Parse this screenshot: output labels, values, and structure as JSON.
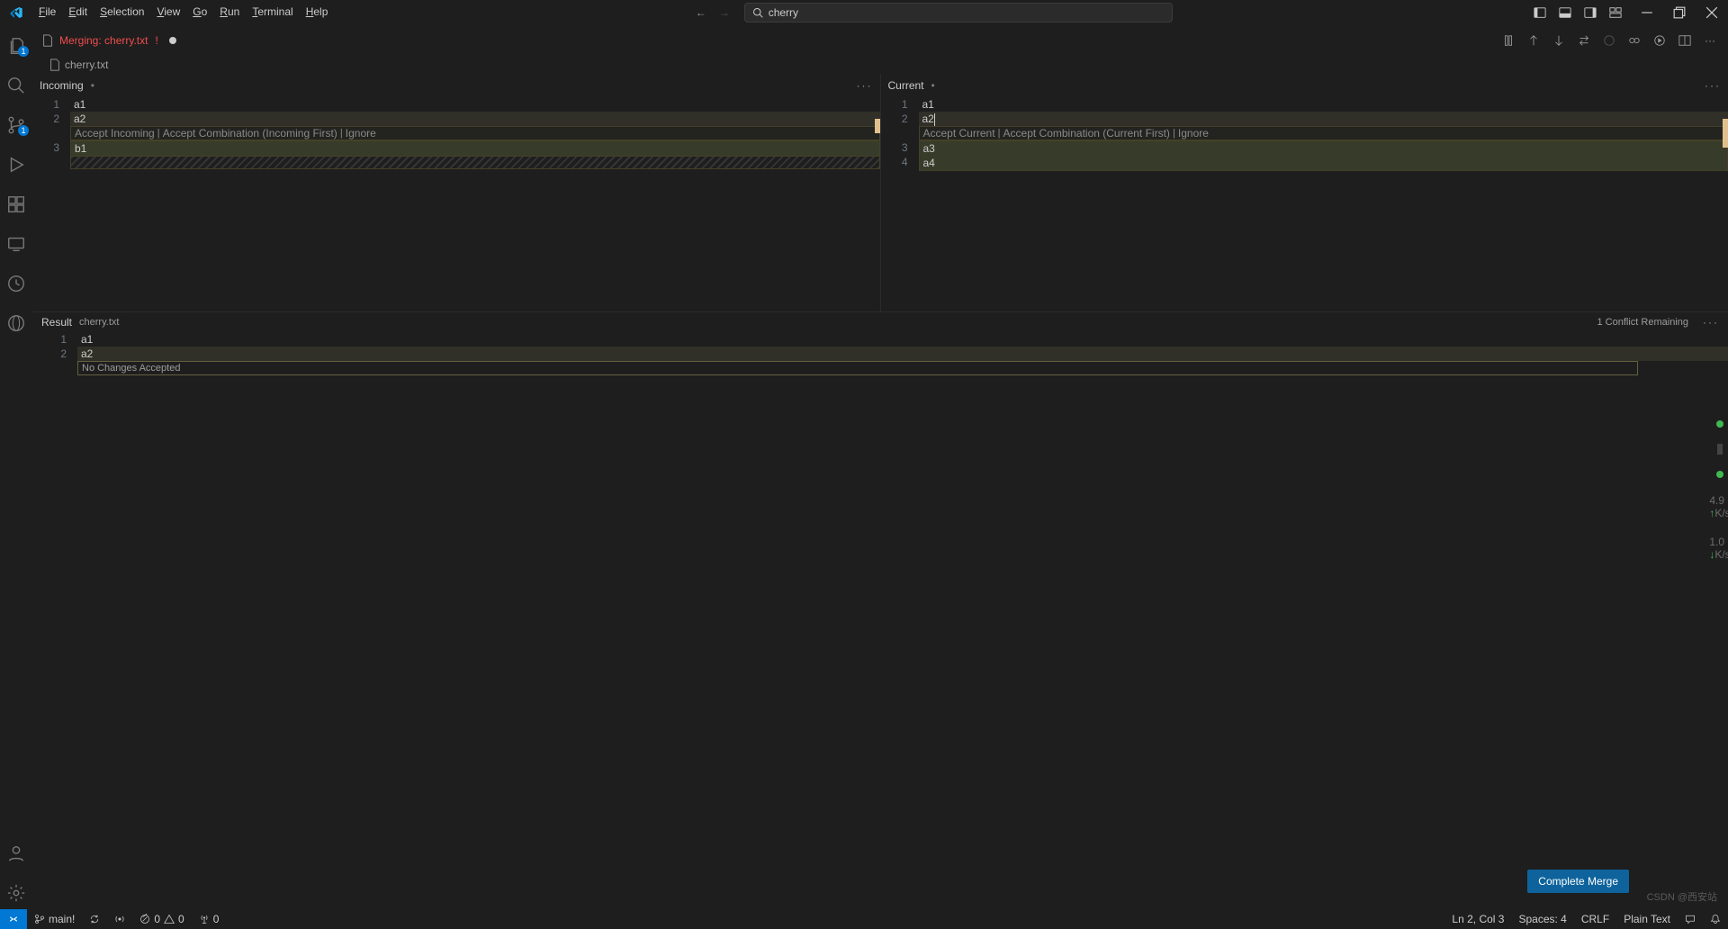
{
  "menubar": {
    "file": "File",
    "edit": "Edit",
    "selection": "Selection",
    "view": "View",
    "go": "Go",
    "run": "Run",
    "terminal": "Terminal",
    "help": "Help"
  },
  "search": {
    "value": "cherry"
  },
  "activitybar": {
    "explorer_badge": "1",
    "scm_badge": "1"
  },
  "tabs": {
    "merge_label": "Merging: cherry.txt",
    "merge_status": "!",
    "breadcrumb_file": "cherry.txt"
  },
  "incoming": {
    "title": "Incoming",
    "codelens_accept": "Accept Incoming",
    "codelens_combo": "Accept Combination (Incoming First)",
    "codelens_ignore": "Ignore",
    "lines": {
      "l1": "a1",
      "l2": "a2",
      "l3": "b1"
    },
    "nums": {
      "n1": "1",
      "n2": "2",
      "n3": "3"
    }
  },
  "current": {
    "title": "Current",
    "codelens_accept": "Accept Current",
    "codelens_combo": "Accept Combination (Current First)",
    "codelens_ignore": "Ignore",
    "lines": {
      "l1": "a1",
      "l2": "a2",
      "l3": "a3",
      "l4": "a4"
    },
    "nums": {
      "n1": "1",
      "n2": "2",
      "n3": "3",
      "n4": "4"
    }
  },
  "result": {
    "title": "Result",
    "file": "cherry.txt",
    "conflicts": "1 Conflict Remaining",
    "lines": {
      "l1": "a1",
      "l2": "a2"
    },
    "nums": {
      "n1": "1",
      "n2": "2"
    },
    "no_changes": "No Changes Accepted",
    "complete_merge": "Complete Merge"
  },
  "status": {
    "branch": "main!",
    "errors": "0",
    "warnings": "0",
    "ports": "0",
    "ln_col": "Ln 2, Col 3",
    "spaces": "Spaces: 4",
    "eol": "CRLF",
    "lang": "Plain Text"
  },
  "rightstrip": {
    "v1": "4.9",
    "u1": "K/s",
    "v2": "1.0",
    "u2": "K/s"
  },
  "watermark": "CSDN @西安站"
}
